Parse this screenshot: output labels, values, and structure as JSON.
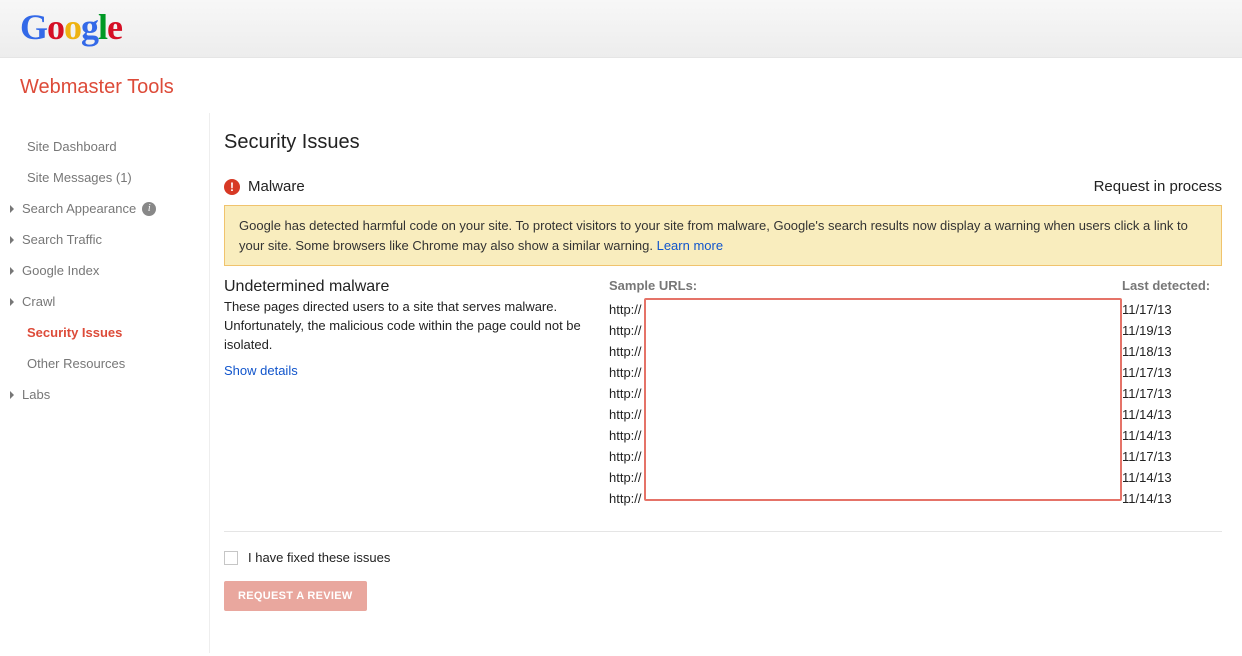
{
  "logo": {
    "G": "G",
    "o1": "o",
    "o2": "o",
    "g": "g",
    "l": "l",
    "e": "e"
  },
  "product_title": "Webmaster Tools",
  "sidebar": {
    "dashboard": "Site Dashboard",
    "messages": "Site Messages (1)",
    "appearance": "Search Appearance",
    "traffic": "Search Traffic",
    "gindex": "Google Index",
    "crawl": "Crawl",
    "security": "Security Issues",
    "other": "Other Resources",
    "labs": "Labs"
  },
  "page": {
    "title": "Security Issues",
    "issue_name": "Malware",
    "issue_status": "Request in process",
    "notice_text": "Google has detected harmful code on your site. To protect visitors to your site from malware, Google's search results now display a warning when users click a link to your site. Some browsers like Chrome may also show a similar warning. ",
    "learn_more": "Learn more",
    "detail_title": "Undetermined malware",
    "detail_desc": "These pages directed users to a site that serves malware. Unfortunately, the malicious code within the page could not be isolated.",
    "show_details": "Show details",
    "col_urls": "Sample URLs:",
    "col_date": "Last detected:",
    "rows": [
      {
        "url": "http://",
        "date": "11/17/13"
      },
      {
        "url": "http://",
        "date": "11/19/13"
      },
      {
        "url": "http://",
        "date": "11/18/13"
      },
      {
        "url": "http://",
        "date": "11/17/13"
      },
      {
        "url": "http://",
        "date": "11/17/13"
      },
      {
        "url": "http://",
        "date": "11/14/13"
      },
      {
        "url": "http://",
        "date": "11/14/13"
      },
      {
        "url": "http://",
        "date": "11/17/13"
      },
      {
        "url": "http://",
        "date": "11/14/13"
      },
      {
        "url": "http://",
        "date": "11/14/13"
      }
    ],
    "fixed_label": "I have fixed these issues",
    "review_btn": "REQUEST A REVIEW"
  }
}
